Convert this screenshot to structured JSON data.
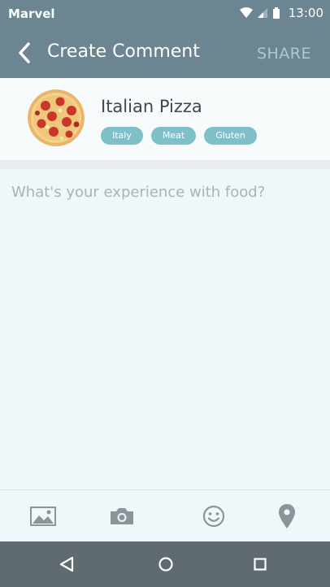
{
  "status_bar": {
    "carrier": "Marvel",
    "time": "13:00"
  },
  "app_bar": {
    "title": "Create Comment",
    "share_label": "SHARE"
  },
  "food": {
    "name": "Italian Pizza",
    "tags": [
      "Italy",
      "Meat",
      "Gluten"
    ]
  },
  "comment": {
    "placeholder": "What's your experience with food?",
    "value": ""
  },
  "toolbar": {
    "icons": [
      "image-icon",
      "camera-icon",
      "emoji-icon",
      "location-pin-icon"
    ]
  },
  "nav": {
    "icons": [
      "back-triangle-icon",
      "home-circle-icon",
      "recents-square-icon"
    ]
  },
  "colors": {
    "primary": "#6b8690",
    "accent": "#7fbfca",
    "nav": "#5f6b70",
    "background": "#eef7fa"
  }
}
